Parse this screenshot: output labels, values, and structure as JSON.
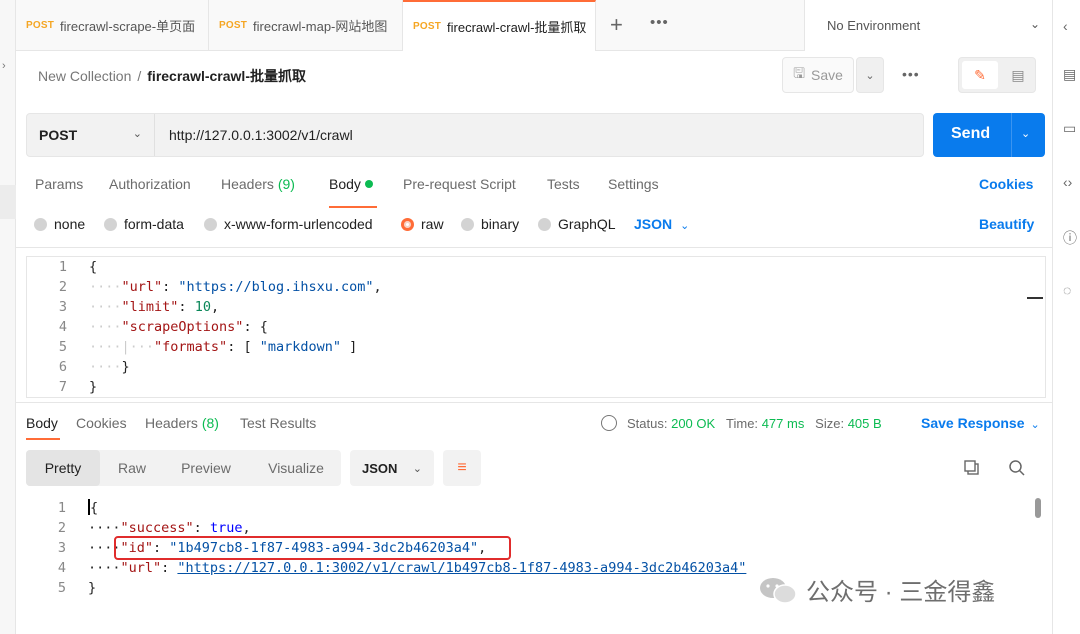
{
  "tabs": [
    {
      "method": "POST",
      "title": "firecrawl-scrape-单页面"
    },
    {
      "method": "POST",
      "title": "firecrawl-map-网站地图"
    },
    {
      "method": "POST",
      "title": "firecrawl-crawl-批量抓取"
    }
  ],
  "environment": "No Environment",
  "breadcrumb": {
    "collection": "New Collection",
    "separator": "/",
    "current": "firecrawl-crawl-批量抓取"
  },
  "toolbar": {
    "save_label": "Save"
  },
  "request": {
    "method": "POST",
    "url": "http://127.0.0.1:3002/v1/crawl",
    "send_label": "Send",
    "tabs": {
      "params": "Params",
      "authorization": "Authorization",
      "headers": "Headers",
      "headers_count": "(9)",
      "body": "Body",
      "prerequest": "Pre-request Script",
      "tests": "Tests",
      "settings": "Settings"
    },
    "cookies_label": "Cookies",
    "body_types": [
      "none",
      "form-data",
      "x-www-form-urlencoded",
      "raw",
      "binary",
      "GraphQL"
    ],
    "body_format": "JSON",
    "beautify_label": "Beautify",
    "line_numbers": [
      "1",
      "2",
      "3",
      "4",
      "5",
      "6",
      "7"
    ],
    "body_lines": {
      "l1": "{",
      "l2_key": "\"url\"",
      "l2_val": "\"https://blog.ihsxu.com\"",
      "l3_key": "\"limit\"",
      "l3_val": "10",
      "l4_key": "\"scrapeOptions\"",
      "l4_rest": "{",
      "l5_key": "\"formats\"",
      "l5_val": "\"markdown\"",
      "l6": "}",
      "l7": "}"
    }
  },
  "response": {
    "tabs": {
      "body": "Body",
      "cookies": "Cookies",
      "headers": "Headers",
      "headers_count": "(8)",
      "test_results": "Test Results"
    },
    "status_label": "Status:",
    "status_value": "200 OK",
    "time_label": "Time:",
    "time_value": "477 ms",
    "size_label": "Size:",
    "size_value": "405 B",
    "save_response_label": "Save Response",
    "view_tabs": [
      "Pretty",
      "Raw",
      "Preview",
      "Visualize"
    ],
    "format": "JSON",
    "line_numbers": [
      "1",
      "2",
      "3",
      "4",
      "5"
    ],
    "body_lines": {
      "l1": "{",
      "l2_key": "\"success\"",
      "l2_val": "true",
      "l3_key": "\"id\"",
      "l3_val": "\"1b497cb8-1f87-4983-a994-3dc2b46203a4\"",
      "l4_key": "\"url\"",
      "l4_val": "\"https://127.0.0.1:3002/v1/crawl/1b497cb8-1f87-4983-a994-3dc2b46203a4\"",
      "l5": "}"
    }
  },
  "watermark": "公众号 · 三金得鑫",
  "colors": {
    "accent": "#ff6c37",
    "primary": "#097bed",
    "success": "#0cbb52",
    "highlight": "#e02c2c"
  }
}
